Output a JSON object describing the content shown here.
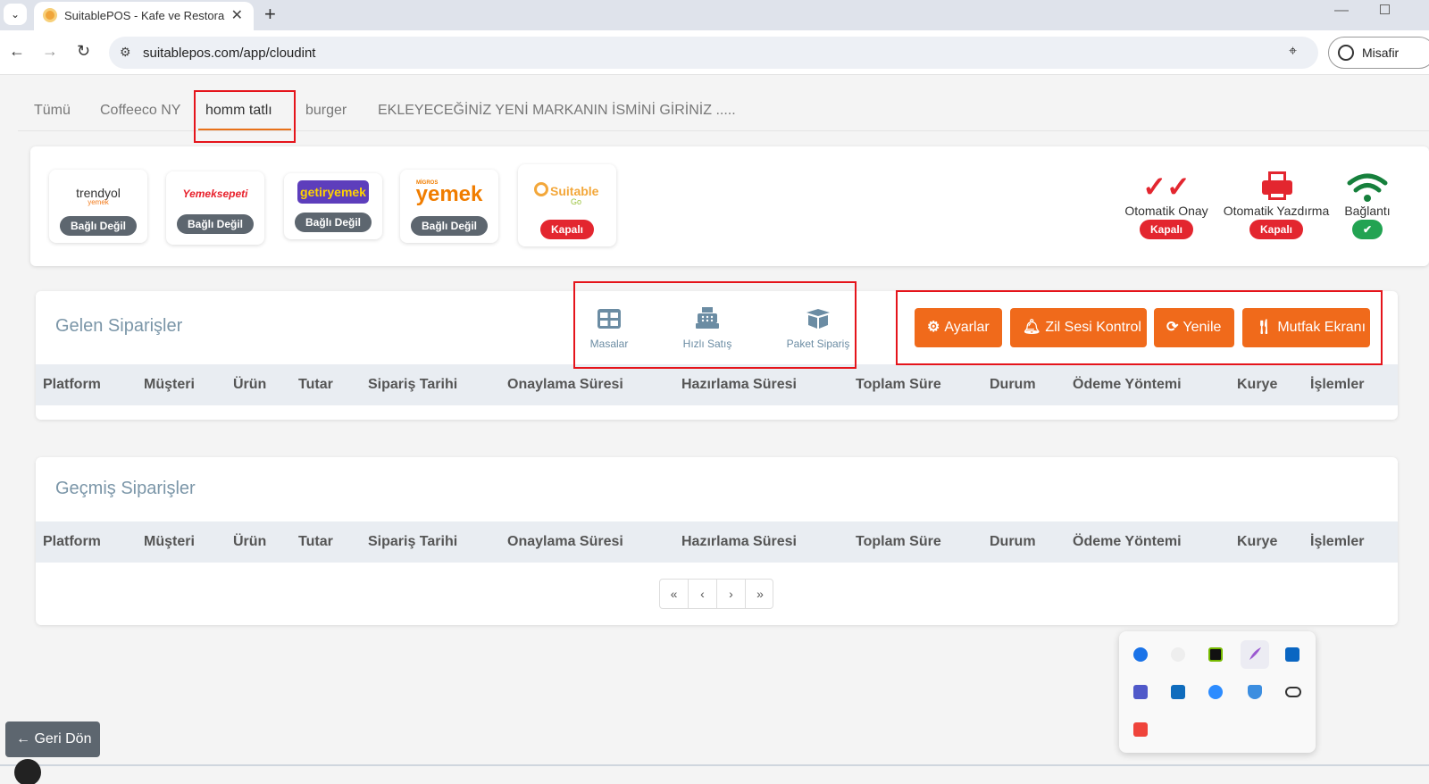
{
  "browser": {
    "tab_title": "SuitablePOS - Kafe ve Restoran Y",
    "url": "suitablepos.com/app/cloudint",
    "profile_label": "Misafir"
  },
  "brand_tabs": [
    "Tümü",
    "Coffeeco NY",
    "homm tatlı",
    "burger",
    "EKLEYECEĞİNİZ YENİ MARKANIN İSMİNİ GİRİNİZ ....."
  ],
  "integrations": [
    {
      "logo_main": "trendyol",
      "logo_sub": "yemek",
      "status": "Bağlı Değil"
    },
    {
      "logo_main": "Yemeksepeti",
      "status": "Bağlı Değil"
    },
    {
      "logo_main": "getiryemek",
      "status": "Bağlı Değil"
    },
    {
      "logo_main": "yemek",
      "logo_sub": "MİGROS",
      "status": "Bağlı Değil"
    },
    {
      "logo_main": "Suitable",
      "logo_sub": "Go",
      "status": "Kapalı"
    }
  ],
  "status_items": [
    {
      "label": "Otomatik Onay",
      "badge": "Kapalı"
    },
    {
      "label": "Otomatik Yazdırma",
      "badge": "Kapalı"
    },
    {
      "label": "Bağlantı",
      "badge": "✔"
    }
  ],
  "incoming": {
    "title": "Gelen Siparişler",
    "quick_actions": [
      "Masalar",
      "Hızlı Satış",
      "Paket Sipariş"
    ],
    "buttons": [
      "Ayarlar",
      "Zil Sesi Kontrol",
      "Yenile",
      "Mutfak Ekranı"
    ]
  },
  "past": {
    "title": "Geçmiş Siparişler"
  },
  "columns": [
    "Platform",
    "Müşteri",
    "Ürün",
    "Tutar",
    "Sipariş Tarihi",
    "Onaylama Süresi",
    "Hazırlama Süresi",
    "Toplam Süre",
    "Durum",
    "Ödeme Yöntemi",
    "Kurye",
    "İşlemler"
  ],
  "pagination": [
    "«",
    "‹",
    "›",
    "»"
  ],
  "tray_icons": [
    "edge-icon",
    "chrome-icon",
    "nvidia-icon",
    "feather-icon",
    "linkedin-icon",
    "teams-icon",
    "outlook-icon",
    "zoom-icon",
    "defender-icon",
    "onedrive-icon",
    "anydesk-icon"
  ],
  "back_button": "Geri Dön",
  "colors": {
    "accent": "#f06a1b",
    "danger": "#e3262f",
    "success": "#22a352"
  }
}
